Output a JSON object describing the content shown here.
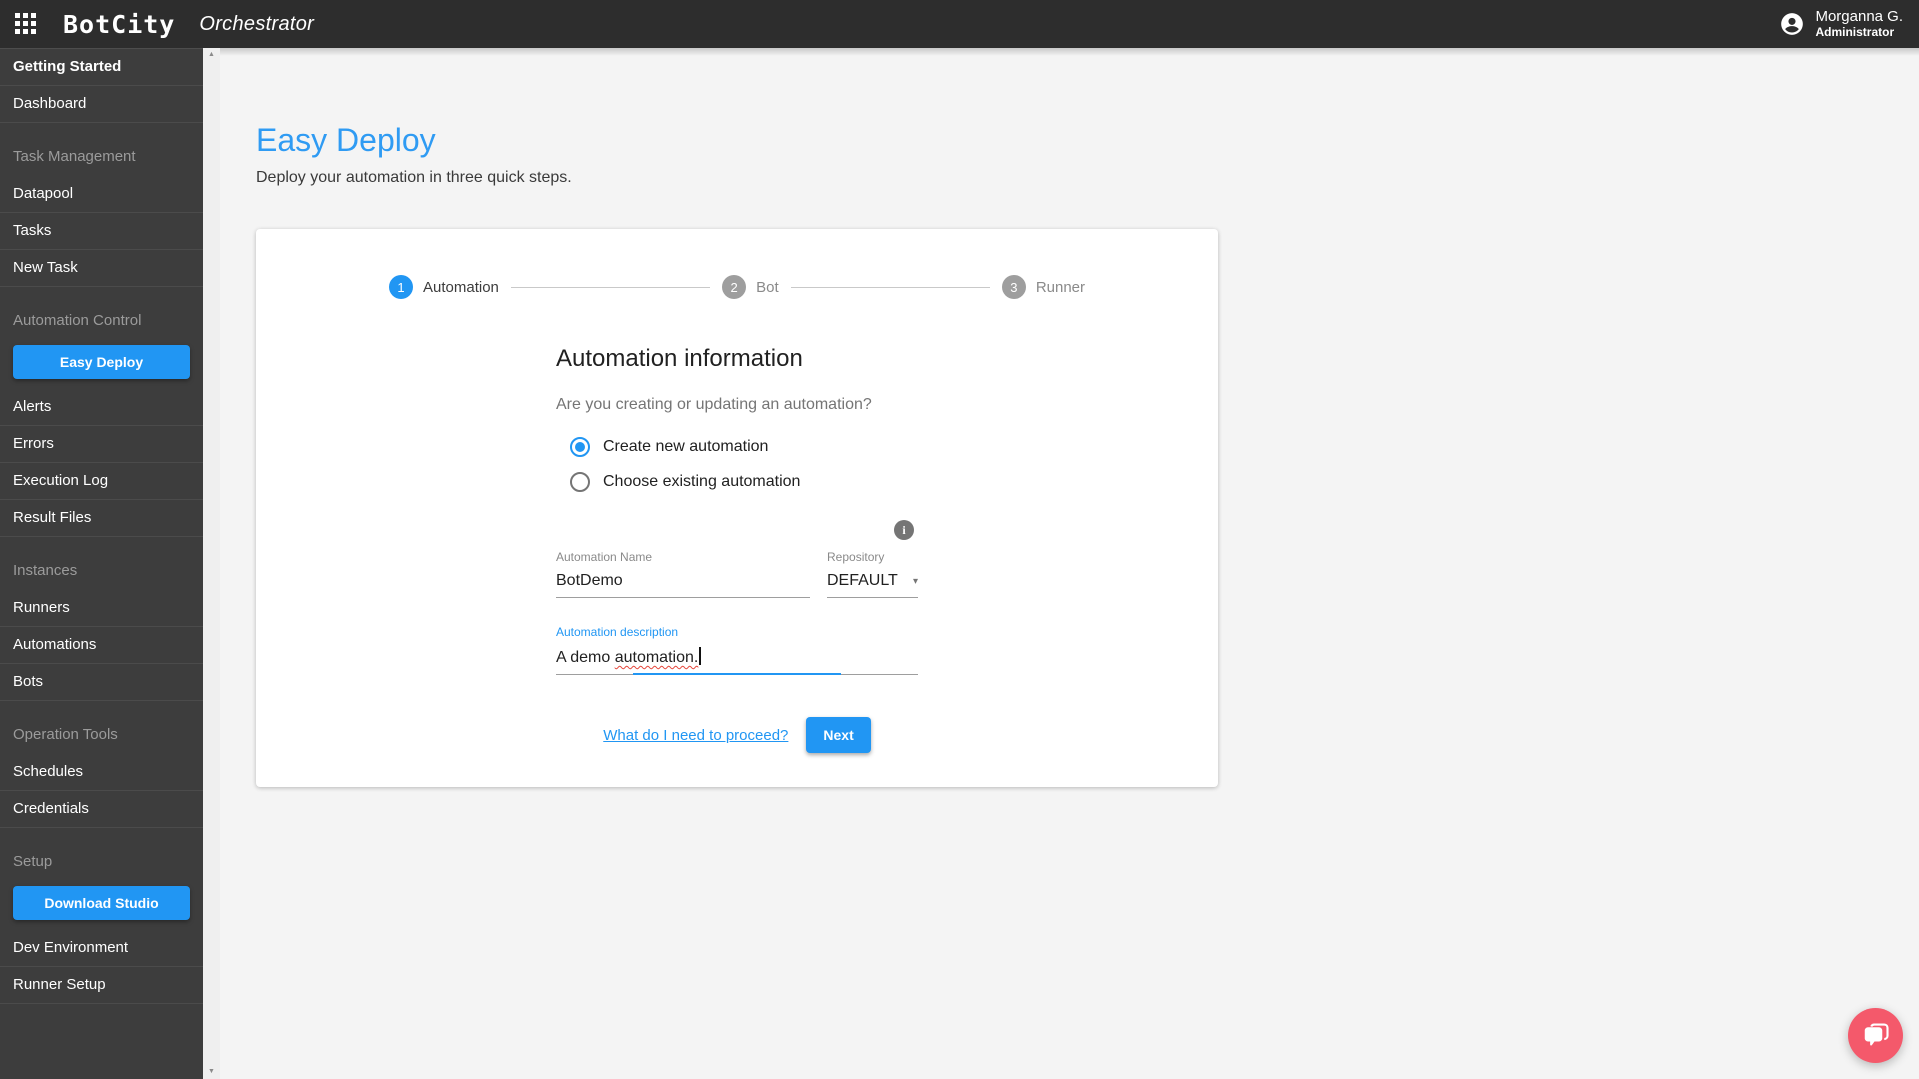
{
  "header": {
    "logo": "BotCity",
    "app_name": "Orchestrator",
    "user_name": "Morganna G.",
    "user_role": "Administrator"
  },
  "icons": {
    "info_glyph": "i",
    "dropdown_glyph": "▾",
    "scroll_up_glyph": "▲",
    "scroll_down_glyph": "▼"
  },
  "sidebar": {
    "sections": [
      {
        "items": [
          "Getting Started",
          "Dashboard"
        ]
      },
      {
        "title": "Task Management",
        "items": [
          "Datapool",
          "Tasks",
          "New Task"
        ]
      },
      {
        "title": "Automation Control",
        "button": "Easy Deploy",
        "items": [
          "Alerts",
          "Errors",
          "Execution Log",
          "Result Files"
        ]
      },
      {
        "title": "Instances",
        "items": [
          "Runners",
          "Automations",
          "Bots"
        ]
      },
      {
        "title": "Operation Tools",
        "items": [
          "Schedules",
          "Credentials"
        ]
      },
      {
        "title": "Setup",
        "button": "Download Studio",
        "items": [
          "Dev Environment",
          "Runner Setup"
        ]
      }
    ]
  },
  "page": {
    "title": "Easy Deploy",
    "subtitle": "Deploy your automation in three quick steps."
  },
  "stepper": {
    "steps": [
      {
        "number": "1",
        "label": "Automation",
        "active": true
      },
      {
        "number": "2",
        "label": "Bot",
        "active": false
      },
      {
        "number": "3",
        "label": "Runner",
        "active": false
      }
    ]
  },
  "form": {
    "heading": "Automation information",
    "question": "Are you creating or updating an automation?",
    "radio_create": "Create new automation",
    "radio_choose": "Choose existing automation",
    "name_field": {
      "label": "Automation Name",
      "value": "BotDemo"
    },
    "repository_field": {
      "label": "Repository",
      "value": "DEFAULT"
    },
    "description_field": {
      "label": "Automation description",
      "value": "A demo automation.",
      "value_prefix": "A demo ",
      "value_misspelled": "automation."
    },
    "help_link": "What do I need to proceed?",
    "next_button": "Next"
  },
  "colors": {
    "accent": "#2196f3",
    "title_blue": "#2f9bf3",
    "chat_bubble": "#f4596b",
    "topbar": "#2d2d2d",
    "sidebar": "#3d3d3d"
  }
}
